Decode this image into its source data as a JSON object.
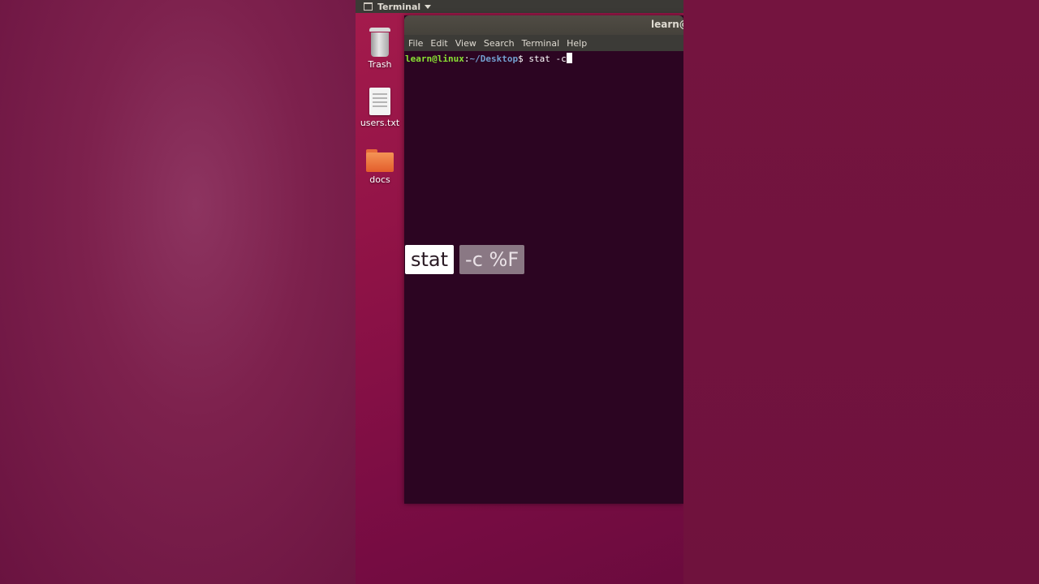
{
  "topbar": {
    "app_title": "Terminal",
    "window_icon": "window-icon",
    "menu_caret": "chevron-down-icon"
  },
  "desktop": {
    "items": [
      {
        "label": "Trash",
        "icon": "trash-icon"
      },
      {
        "label": "users.txt",
        "icon": "text-file-icon"
      },
      {
        "label": "docs",
        "icon": "folder-icon"
      }
    ]
  },
  "terminal": {
    "window_title": "learn@",
    "menu": [
      "File",
      "Edit",
      "View",
      "Search",
      "Terminal",
      "Help"
    ],
    "prompt": {
      "user_host": "learn@linux",
      "separator": ":",
      "path": "~/Desktop",
      "symbol": "$",
      "command": " stat -c"
    }
  },
  "overlay": {
    "command_badge": "stat",
    "argument_badge": "-c %F"
  },
  "colors": {
    "terminal_bg": "#2c0522",
    "prompt_user": "#8ae234",
    "prompt_path": "#729fcf",
    "desktop_accent": "#8e1246"
  }
}
